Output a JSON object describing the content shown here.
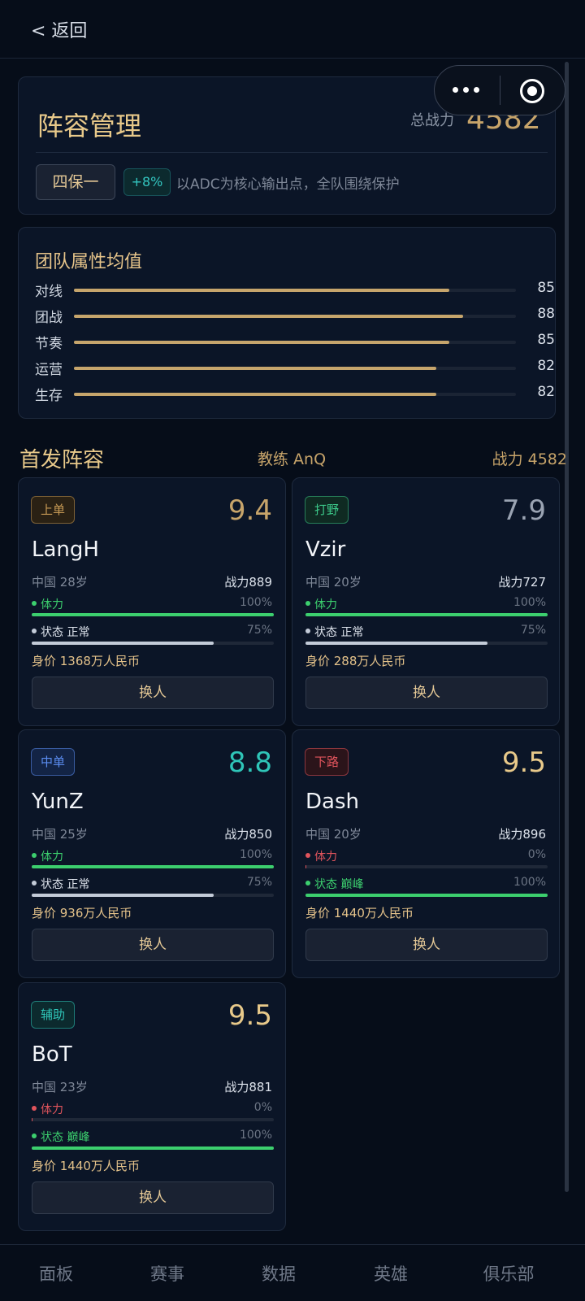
{
  "nav": {
    "back_label": "< 返回"
  },
  "lineup": {
    "title": "阵容管理",
    "total_power_label": "总战力",
    "total_power": "4582",
    "formation": "四保一",
    "bonus": "+8%",
    "description": "以ADC为核心输出点，全队围绕保护"
  },
  "team_attributes": {
    "title": "团队属性均值",
    "items": [
      {
        "label": "对线",
        "value": 85
      },
      {
        "label": "团战",
        "value": 88
      },
      {
        "label": "节奏",
        "value": 85
      },
      {
        "label": "运营",
        "value": 82
      },
      {
        "label": "生存",
        "value": 82
      }
    ]
  },
  "starters": {
    "title": "首发阵容",
    "coach": "教练 AnQ",
    "power": "战力 4582"
  },
  "players": [
    {
      "position": "上单",
      "rating": "9.4",
      "name": "LangH",
      "meta": "中国 28岁",
      "power": "战力889",
      "stamina_label": "体力",
      "stamina_pct": 100,
      "stamina_text": "100%",
      "state_label": "状态 正常",
      "state_pct": 75,
      "state_text": "75%",
      "value": "身价 1368万人民币",
      "swap": "换人",
      "pos_color": "#c79a55",
      "pos_bg": "#2a2114",
      "rating_color": "#c7a46a",
      "stamina_color": "#3ccf6e",
      "state_color": "#c3cbd8"
    },
    {
      "position": "打野",
      "rating": "7.9",
      "name": "Vzir",
      "meta": "中国 20岁",
      "power": "战力727",
      "stamina_label": "体力",
      "stamina_pct": 100,
      "stamina_text": "100%",
      "state_label": "状态 正常",
      "state_pct": 75,
      "state_text": "75%",
      "value": "身价 288万人民币",
      "swap": "换人",
      "pos_color": "#3cc98a",
      "pos_bg": "#0f2a22",
      "rating_color": "#9aa3b2",
      "stamina_color": "#3ccf6e",
      "state_color": "#c3cbd8"
    },
    {
      "position": "中单",
      "rating": "8.8",
      "name": "YunZ",
      "meta": "中国 25岁",
      "power": "战力850",
      "stamina_label": "体力",
      "stamina_pct": 100,
      "stamina_text": "100%",
      "state_label": "状态 正常",
      "state_pct": 75,
      "state_text": "75%",
      "value": "身价 936万人民币",
      "swap": "换人",
      "pos_color": "#5b8df0",
      "pos_bg": "#132445",
      "rating_color": "#2fc5b8",
      "stamina_color": "#3ccf6e",
      "state_color": "#c3cbd8"
    },
    {
      "position": "下路",
      "rating": "9.5",
      "name": "Dash",
      "meta": "中国 20岁",
      "power": "战力896",
      "stamina_label": "体力",
      "stamina_pct": 0,
      "stamina_text": "0%",
      "state_label": "状态 巅峰",
      "state_pct": 100,
      "state_text": "100%",
      "value": "身价 1440万人民币",
      "swap": "换人",
      "pos_color": "#e0545c",
      "pos_bg": "#2b141a",
      "rating_color": "#e8c98a",
      "stamina_color": "#e0545c",
      "state_color": "#3ccf6e"
    },
    {
      "position": "辅助",
      "rating": "9.5",
      "name": "BoT",
      "meta": "中国 23岁",
      "power": "战力881",
      "stamina_label": "体力",
      "stamina_pct": 0,
      "stamina_text": "0%",
      "state_label": "状态 巅峰",
      "state_pct": 100,
      "state_text": "100%",
      "value": "身价 1440万人民币",
      "swap": "换人",
      "pos_color": "#2fc5b8",
      "pos_bg": "#0c2a2e",
      "rating_color": "#e8c98a",
      "stamina_color": "#e0545c",
      "state_color": "#3ccf6e"
    }
  ],
  "tabbar": {
    "items": [
      "面板",
      "赛事",
      "数据",
      "英雄",
      "俱乐部"
    ]
  }
}
